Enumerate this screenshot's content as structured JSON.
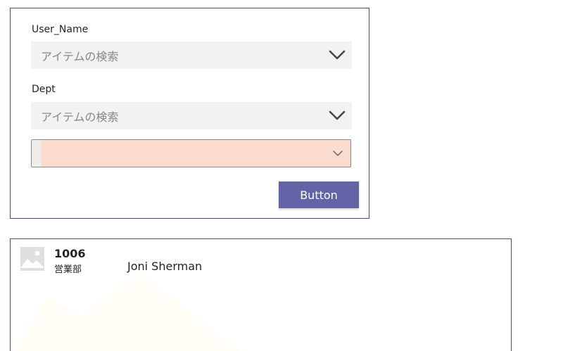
{
  "form": {
    "user_name_label": "User_Name",
    "user_name_placeholder": "アイテムの検索",
    "dept_label": "Dept",
    "dept_placeholder": "アイテムの検索",
    "dropdown_value": "",
    "button_label": "Button"
  },
  "gallery": {
    "items": [
      {
        "id": "1006",
        "dept": "営業部",
        "name": "Joni Sherman"
      }
    ]
  },
  "colors": {
    "accent": "#6264a7",
    "card_border": "#4b4a82",
    "combo_bg": "#f3f2f1",
    "dropdown_bg": "#fadbcd"
  }
}
